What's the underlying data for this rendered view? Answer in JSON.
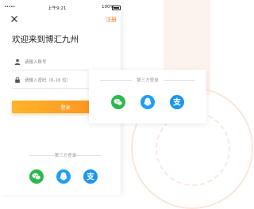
{
  "statusbar": {
    "carrier": "•••••",
    "time": "上午9:21",
    "battery": "100%"
  },
  "header": {
    "close_icon": "close-icon",
    "register_label": "注册"
  },
  "welcome_title": "欢迎来到博汇九州",
  "form": {
    "account_placeholder": "请输入账号",
    "password_placeholder": "请输入密码（6-16 位）",
    "login_label": "登录"
  },
  "third_party": {
    "label": "第三方登录",
    "providers": [
      {
        "name": "wechat-icon",
        "color": "#2db84d"
      },
      {
        "name": "qq-icon",
        "color": "#1f9ef0"
      },
      {
        "name": "alipay-icon",
        "color": "#1b96ea"
      }
    ]
  },
  "colors": {
    "accent": "#ff7a1a",
    "button_start": "#ffb52a",
    "button_end": "#ff8a1e"
  }
}
